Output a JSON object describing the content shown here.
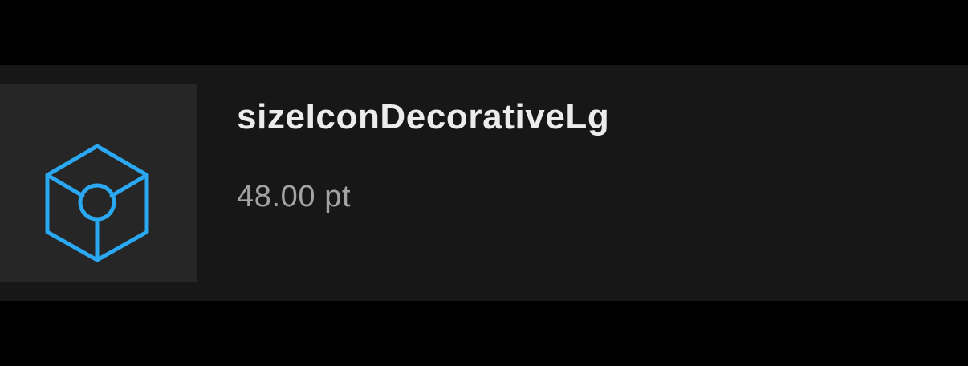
{
  "token": {
    "name": "sizeIconDecorativeLg",
    "value": "48.00 pt",
    "icon": "cube-icon"
  },
  "colors": {
    "page_background": "#000000",
    "row_background": "#171717",
    "tile_background": "#262626",
    "icon_accent": "#2aa8f2",
    "name_text": "#ececec",
    "value_text": "#a3a3a3"
  }
}
